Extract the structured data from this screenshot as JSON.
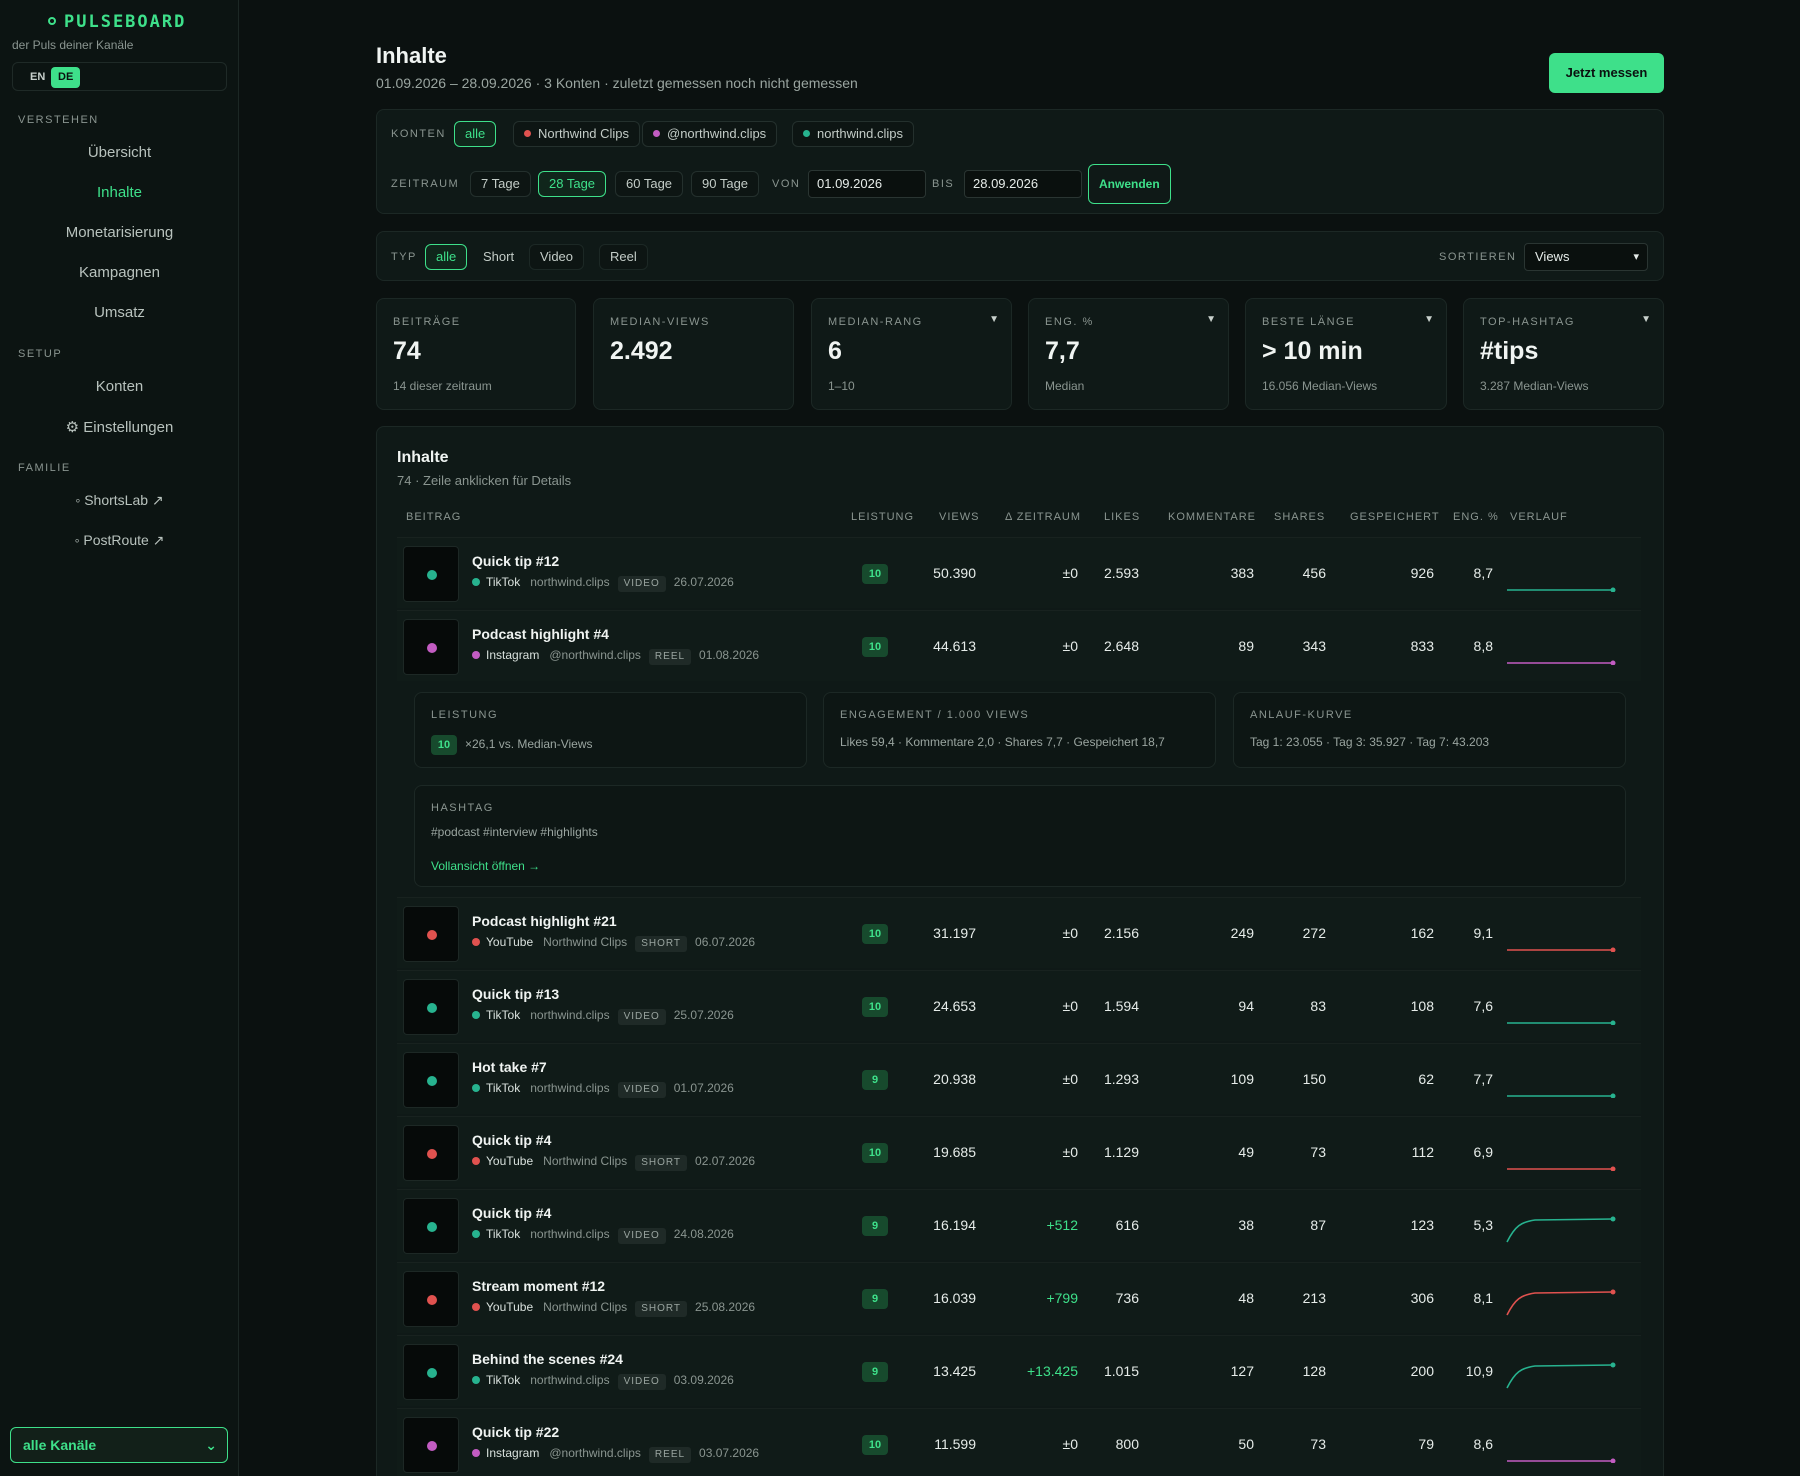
{
  "sidebar": {
    "brand": "PULSEBOARD",
    "tagline": "der Puls deiner Kanäle",
    "lang": {
      "en": "EN",
      "de": "DE"
    },
    "sections": [
      {
        "label": "VERSTEHEN",
        "items": [
          "Übersicht",
          "Inhalte",
          "Monetarisierung",
          "Kampagnen",
          "Umsatz"
        ]
      },
      {
        "label": "SETUP",
        "items": [
          "Konten",
          "⚙ Einstellungen"
        ]
      },
      {
        "label": "FAMILIE",
        "items": [
          "◦ ShortsLab ↗",
          "◦ PostRoute ↗"
        ]
      }
    ],
    "channel_select": "alle Kanäle"
  },
  "header": {
    "title": "Inhalte",
    "subtitle": "01.09.2026 – 28.09.2026 · 3 Konten · zuletzt gemessen noch nicht gemessen",
    "measure_button": "Jetzt messen"
  },
  "filters": {
    "accounts_label": "KONTEN",
    "accounts": [
      {
        "label": "alle",
        "color": ""
      },
      {
        "label": "Northwind Clips",
        "color": "#e0524f"
      },
      {
        "label": "@northwind.clips",
        "color": "#c25cc2"
      },
      {
        "label": "northwind.clips",
        "color": "#27b38f"
      }
    ],
    "range_label": "ZEITRAUM",
    "ranges": [
      "7 Tage",
      "28 Tage",
      "60 Tage",
      "90 Tage"
    ],
    "from_label": "VON",
    "from_value": "01.09.2026",
    "to_label": "BIS",
    "to_value": "28.09.2026",
    "apply_button": "Anwenden",
    "type_label": "TYP",
    "types": [
      "alle",
      "Short",
      "Video",
      "Reel"
    ],
    "sort_label": "SORTIEREN",
    "sort_value": "Views"
  },
  "kpis": [
    {
      "label": "BEITRÄGE",
      "value": "74",
      "sub": "14 dieser zeitraum",
      "caret": false
    },
    {
      "label": "MEDIAN-VIEWS",
      "value": "2.492",
      "sub": "",
      "caret": false
    },
    {
      "label": "MEDIAN-RANG",
      "value": "6",
      "sub": "1–10",
      "caret": true
    },
    {
      "label": "ENG. %",
      "value": "7,7",
      "sub": "Median",
      "caret": true
    },
    {
      "label": "BESTE LÄNGE",
      "value": "> 10 min",
      "sub": "16.056 Median-Views",
      "caret": true
    },
    {
      "label": "TOP-HASHTAG",
      "value": "#tips",
      "sub": "3.287 Median-Views",
      "caret": true
    }
  ],
  "table": {
    "title": "Inhalte",
    "subtitle": "74 · Zeile anklicken für Details",
    "columns": [
      "BEITRAG",
      "LEISTUNG",
      "VIEWS",
      "Δ ZEITRAUM",
      "LIKES",
      "KOMMENTARE",
      "SHARES",
      "GESPEICHERT",
      "ENG. %",
      "VERLAUF"
    ],
    "rows": [
      {
        "title": "Quick tip #12",
        "platform": "TikTok",
        "account": "northwind.clips",
        "type": "VIDEO",
        "date": "26.07.2026",
        "score": "10",
        "views": "50.390",
        "delta": "±0",
        "likes": "2.593",
        "comments": "383",
        "shares": "456",
        "saved": "926",
        "eng": "8,7",
        "color": "#27b38f",
        "trend": "flat"
      },
      {
        "title": "Podcast highlight #4",
        "platform": "Instagram",
        "account": "@northwind.clips",
        "type": "REEL",
        "date": "01.08.2026",
        "score": "10",
        "views": "44.613",
        "delta": "±0",
        "likes": "2.648",
        "comments": "89",
        "shares": "343",
        "saved": "833",
        "eng": "8,8",
        "color": "#c25cc2",
        "trend": "flat"
      },
      {
        "title": "Podcast highlight #21",
        "platform": "YouTube",
        "account": "Northwind Clips",
        "type": "SHORT",
        "date": "06.07.2026",
        "score": "10",
        "views": "31.197",
        "delta": "±0",
        "likes": "2.156",
        "comments": "249",
        "shares": "272",
        "saved": "162",
        "eng": "9,1",
        "color": "#e0524f",
        "trend": "flat"
      },
      {
        "title": "Quick tip #13",
        "platform": "TikTok",
        "account": "northwind.clips",
        "type": "VIDEO",
        "date": "25.07.2026",
        "score": "10",
        "views": "24.653",
        "delta": "±0",
        "likes": "1.594",
        "comments": "94",
        "shares": "83",
        "saved": "108",
        "eng": "7,6",
        "color": "#27b38f",
        "trend": "flat"
      },
      {
        "title": "Hot take #7",
        "platform": "TikTok",
        "account": "northwind.clips",
        "type": "VIDEO",
        "date": "01.07.2026",
        "score": "9",
        "views": "20.938",
        "delta": "±0",
        "likes": "1.293",
        "comments": "109",
        "shares": "150",
        "saved": "62",
        "eng": "7,7",
        "color": "#27b38f",
        "trend": "flat"
      },
      {
        "title": "Quick tip #4",
        "platform": "YouTube",
        "account": "Northwind Clips",
        "type": "SHORT",
        "date": "02.07.2026",
        "score": "10",
        "views": "19.685",
        "delta": "±0",
        "likes": "1.129",
        "comments": "49",
        "shares": "73",
        "saved": "112",
        "eng": "6,9",
        "color": "#e0524f",
        "trend": "flat"
      },
      {
        "title": "Quick tip #4",
        "platform": "TikTok",
        "account": "northwind.clips",
        "type": "VIDEO",
        "date": "24.08.2026",
        "score": "9",
        "views": "16.194",
        "delta": "+512",
        "likes": "616",
        "comments": "38",
        "shares": "87",
        "saved": "123",
        "eng": "5,3",
        "color": "#27b38f",
        "trend": "rise"
      },
      {
        "title": "Stream moment #12",
        "platform": "YouTube",
        "account": "Northwind Clips",
        "type": "SHORT",
        "date": "25.08.2026",
        "score": "9",
        "views": "16.039",
        "delta": "+799",
        "likes": "736",
        "comments": "48",
        "shares": "213",
        "saved": "306",
        "eng": "8,1",
        "color": "#e0524f",
        "trend": "rise"
      },
      {
        "title": "Behind the scenes #24",
        "platform": "TikTok",
        "account": "northwind.clips",
        "type": "VIDEO",
        "date": "03.09.2026",
        "score": "9",
        "views": "13.425",
        "delta": "+13.425",
        "likes": "1.015",
        "comments": "127",
        "shares": "128",
        "saved": "200",
        "eng": "10,9",
        "color": "#27b38f",
        "trend": "rise"
      },
      {
        "title": "Quick tip #22",
        "platform": "Instagram",
        "account": "@northwind.clips",
        "type": "REEL",
        "date": "03.07.2026",
        "score": "10",
        "views": "11.599",
        "delta": "±0",
        "likes": "800",
        "comments": "50",
        "shares": "73",
        "saved": "79",
        "eng": "8,6",
        "color": "#c25cc2",
        "trend": "flat"
      }
    ],
    "detail": {
      "performance_label": "LEISTUNG",
      "performance_score": "10",
      "performance_text": "×26,1 vs. Median-Views",
      "engagement_label": "ENGAGEMENT / 1.000 VIEWS",
      "engagement_text": "Likes 59,4 · Kommentare 2,0 · Shares 7,7 · Gespeichert 18,7",
      "curve_label": "ANLAUF-KURVE",
      "curve_text": "Tag 1: 23.055 · Tag 3: 35.927 · Tag 7: 43.203",
      "hashtag_label": "HASHTAG",
      "hashtag_text": "#podcast #interview #highlights",
      "open_link": "Vollansicht öffnen →"
    }
  }
}
